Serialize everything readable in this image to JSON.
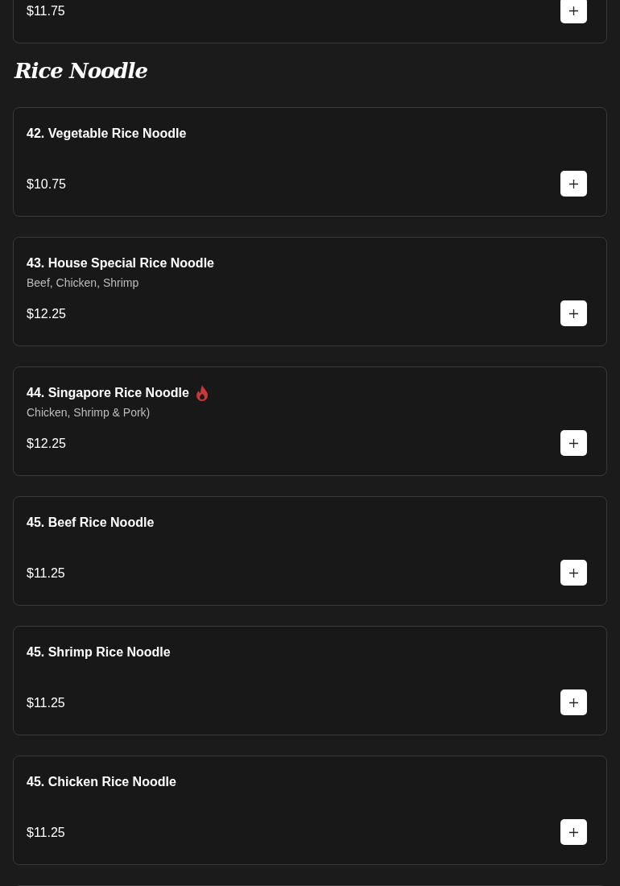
{
  "previous_item": {
    "price": "$11.75"
  },
  "section": {
    "title": "Rice Noodle"
  },
  "items": [
    {
      "name": "42. Vegetable Rice Noodle",
      "spicy": false,
      "price": "$10.75"
    },
    {
      "name": "43. House Special Rice Noodle",
      "spicy": false,
      "description": "Beef, Chicken, Shrimp",
      "price": "$12.25"
    },
    {
      "name": "44. Singapore Rice Noodle",
      "spicy": true,
      "description": "Chicken, Shrimp & Pork)",
      "price": "$12.25"
    },
    {
      "name": "45. Beef Rice Noodle",
      "spicy": false,
      "price": "$11.25"
    },
    {
      "name": "45. Shrimp Rice Noodle",
      "spicy": false,
      "price": "$11.25"
    },
    {
      "name": "45. Chicken Rice Noodle",
      "spicy": false,
      "price": "$11.25"
    }
  ]
}
